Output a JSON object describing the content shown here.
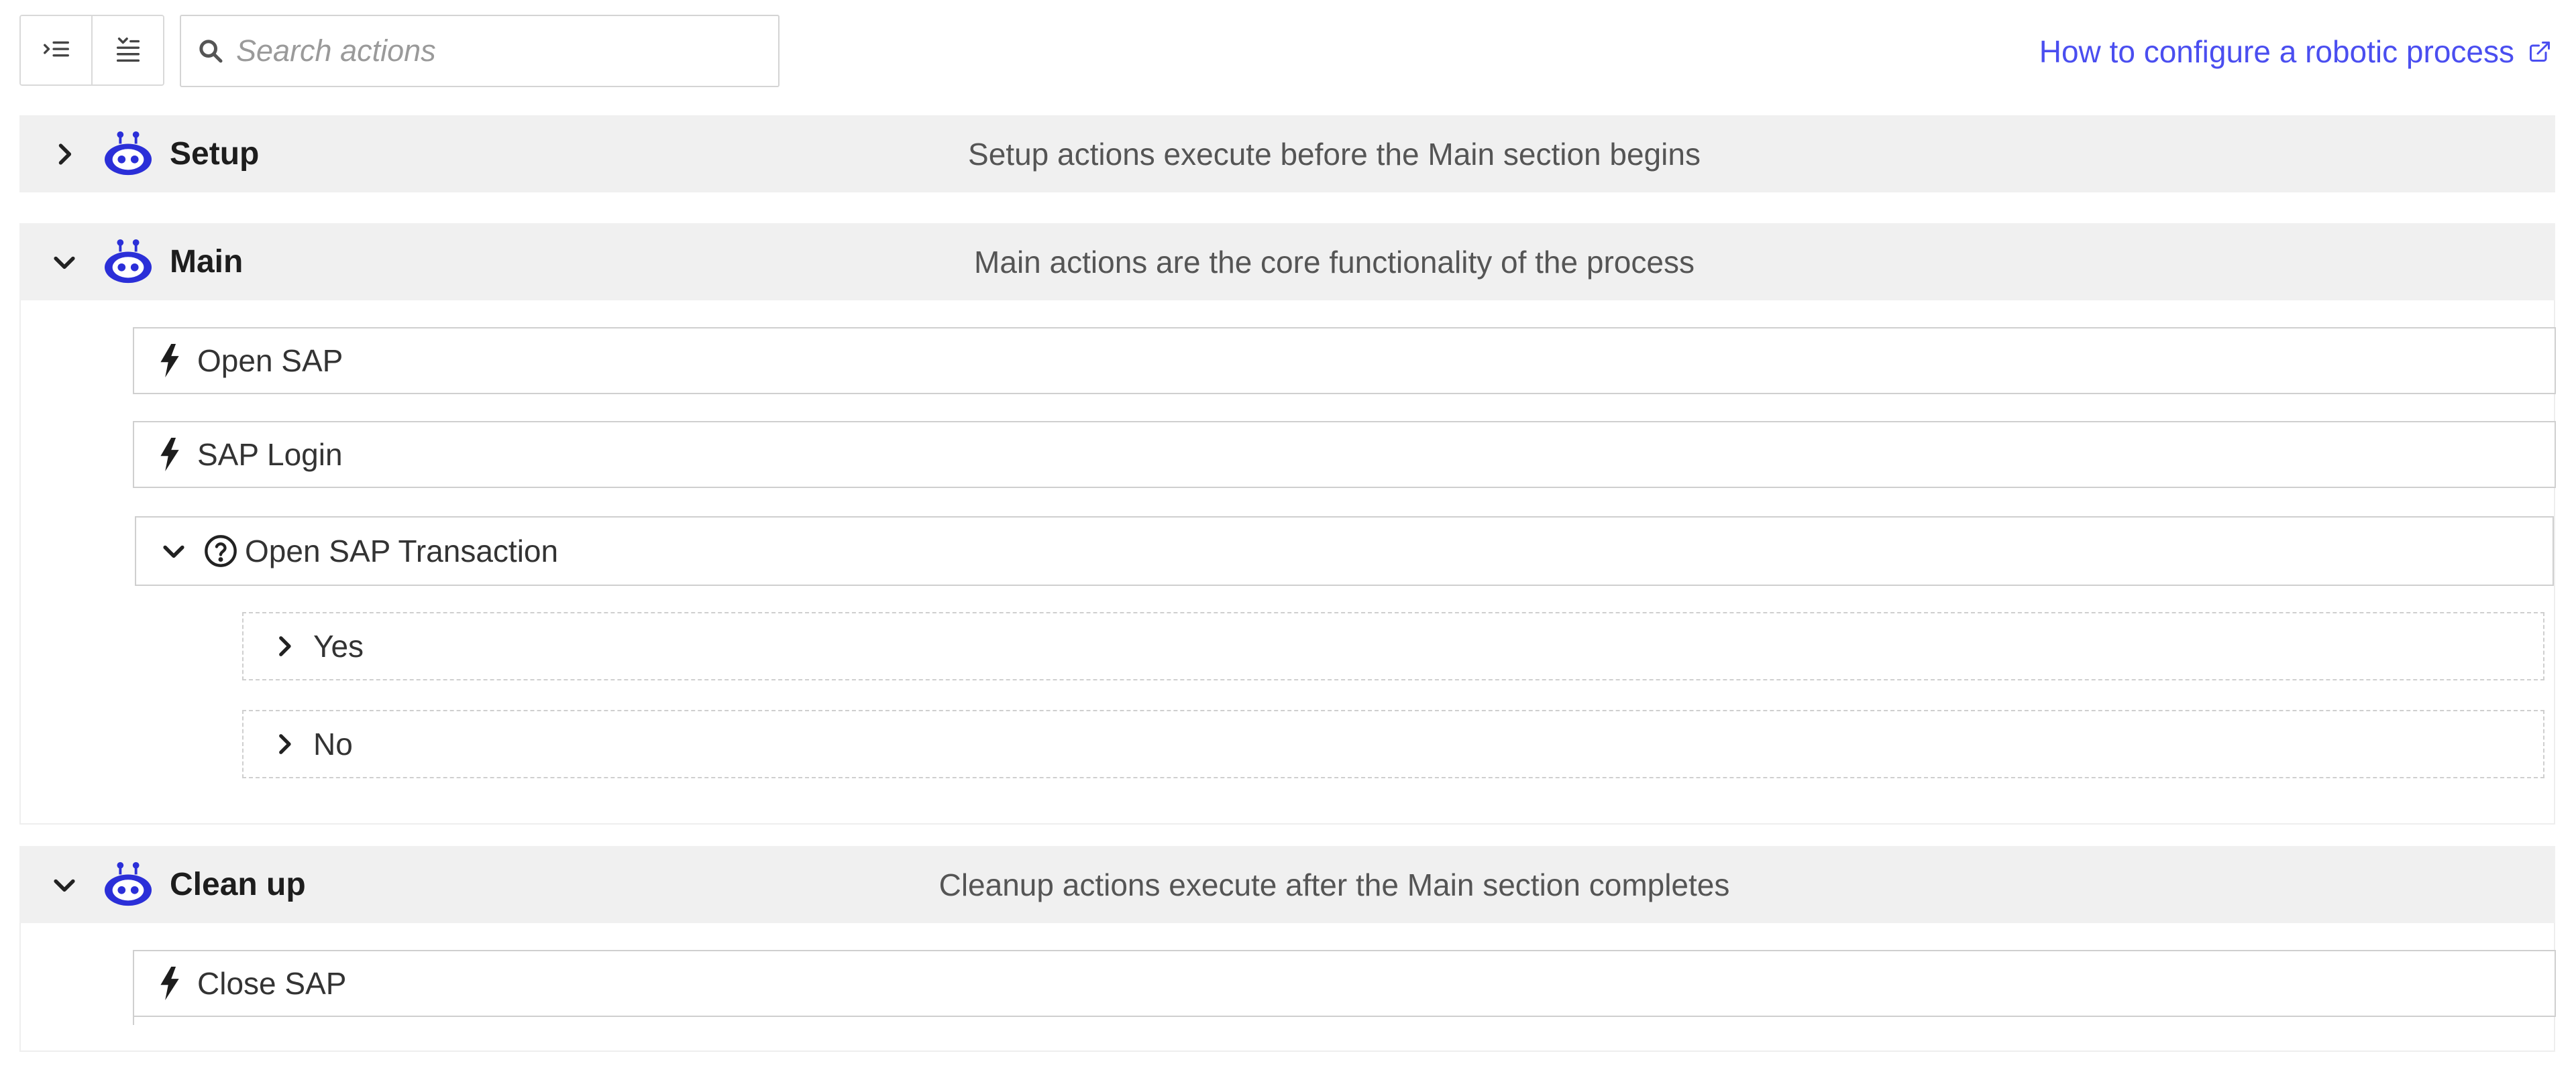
{
  "toolbar": {
    "expand_icon": "expand-all-icon",
    "collapse_icon": "collapse-all-icon",
    "search_icon": "search-icon",
    "search_placeholder": "Search actions",
    "search_value": ""
  },
  "help_link": {
    "label": "How to configure a robotic process",
    "icon": "external-link-icon"
  },
  "colors": {
    "accent": "#4a4ef0",
    "robot": "#2b2fd8",
    "section_header_bg": "#f0f0f0"
  },
  "sections": {
    "setup": {
      "title": "Setup",
      "description": "Setup actions execute before the Main section begins",
      "state": "collapsed"
    },
    "main": {
      "title": "Main",
      "description": "Main actions are the core functionality of the process",
      "state": "expanded",
      "actions": [
        {
          "label": "Open SAP",
          "icon": "lightning-icon"
        },
        {
          "label": "SAP Login",
          "icon": "lightning-icon"
        }
      ],
      "condition": {
        "label": "Open SAP Transaction",
        "icon": "question-circle-icon",
        "branches": [
          {
            "label": "Yes"
          },
          {
            "label": "No"
          }
        ]
      }
    },
    "cleanup": {
      "title": "Clean up",
      "description": "Cleanup actions execute after the Main section completes",
      "state": "expanded",
      "actions": [
        {
          "label": "Close SAP",
          "icon": "lightning-icon"
        }
      ]
    }
  }
}
